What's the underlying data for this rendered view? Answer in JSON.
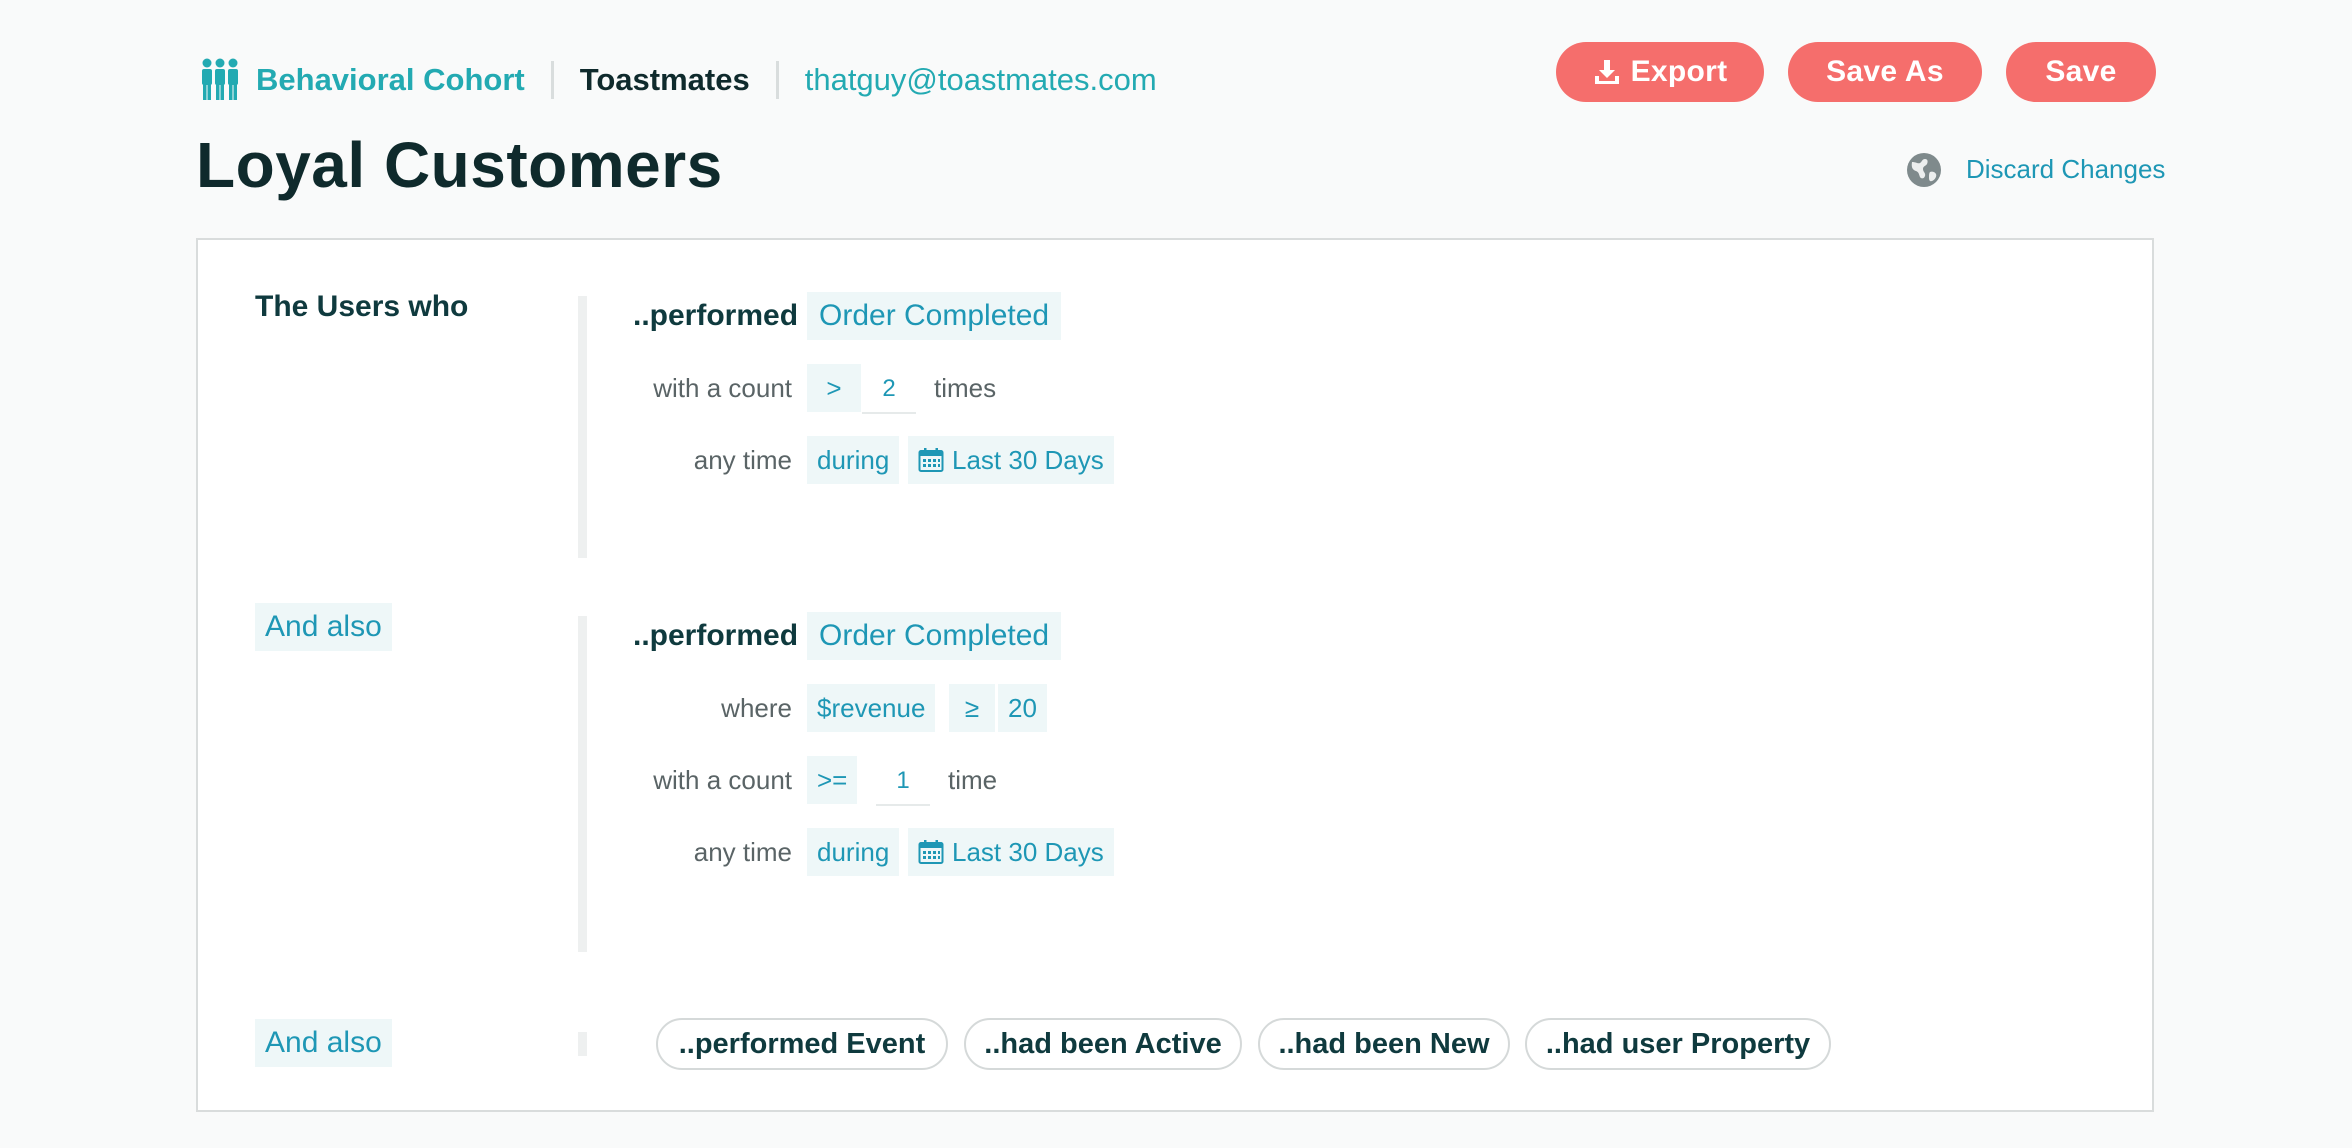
{
  "header": {
    "product": "Behavioral Cohort",
    "org": "Toastmates",
    "email": "thatguy@toastmates.com",
    "export_label": "Export",
    "save_as_label": "Save As",
    "save_label": "Save",
    "discard_label": "Discard Changes"
  },
  "page_title": "Loyal Customers",
  "colors": {
    "accent": "#23aab2",
    "link": "#1e97b5",
    "button": "#f56e6c",
    "tag_bg": "#eef7f8"
  },
  "icons": [
    "people-icon",
    "download-icon",
    "globe-icon",
    "calendar-icon"
  ],
  "cohort": {
    "intro": "The Users who",
    "rule1": {
      "verb": "..performed",
      "event": "Order Completed",
      "count_label": "with a count",
      "operator": ">",
      "count": "2",
      "unit": "times",
      "time_label": "any time",
      "during": "during",
      "range": "Last 30 Days"
    },
    "connector": "And also",
    "rule2": {
      "verb": "..performed",
      "event": "Order Completed",
      "where_label": "where",
      "property": "$revenue",
      "prop_operator": "≥",
      "prop_value": "20",
      "count_label": "with a count",
      "operator": ">=",
      "count": "1",
      "unit": "time",
      "time_label": "any time",
      "during": "during",
      "range": "Last 30 Days"
    },
    "add": {
      "connector": "And also",
      "options": [
        "..performed Event",
        "..had been Active",
        "..had been New",
        "..had user Property"
      ]
    }
  }
}
